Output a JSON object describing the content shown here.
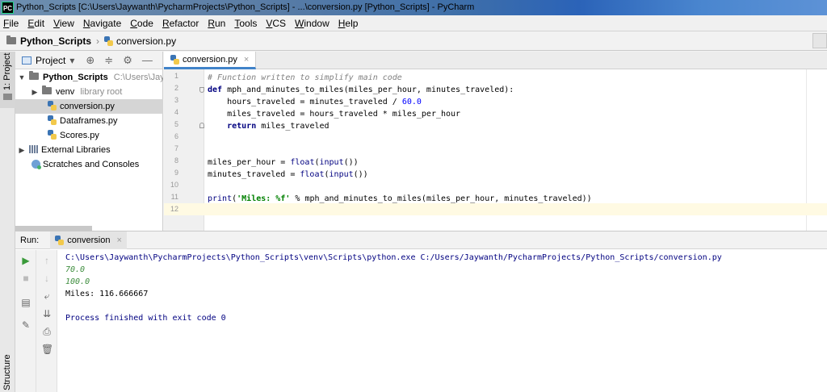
{
  "window": {
    "title": "Python_Scripts [C:\\Users\\Jaywanth\\PycharmProjects\\Python_Scripts] - ...\\conversion.py [Python_Scripts] - PyCharm",
    "logo_text": "PC"
  },
  "menu": [
    {
      "label": "File"
    },
    {
      "label": "Edit"
    },
    {
      "label": "View"
    },
    {
      "label": "Navigate"
    },
    {
      "label": "Code"
    },
    {
      "label": "Refactor"
    },
    {
      "label": "Run"
    },
    {
      "label": "Tools"
    },
    {
      "label": "VCS"
    },
    {
      "label": "Window"
    },
    {
      "label": "Help"
    }
  ],
  "breadcrumb": {
    "project": "Python_Scripts",
    "separator": "›",
    "file": "conversion.py"
  },
  "left_stripe": {
    "project_tab": "1: Project",
    "structure_tab": "Structure"
  },
  "project_panel": {
    "title": "Project",
    "dropdown_arrow": "▾",
    "tree": [
      {
        "label": "Python_Scripts",
        "hint": "C:\\Users\\Jaywa"
      },
      {
        "label": "venv",
        "hint": "library root"
      },
      {
        "label": "conversion.py"
      },
      {
        "label": "Dataframes.py"
      },
      {
        "label": "Scores.py"
      },
      {
        "label": "External Libraries"
      },
      {
        "label": "Scratches and Consoles"
      }
    ]
  },
  "editor": {
    "tab_label": "conversion.py",
    "close_glyph": "×",
    "line_numbers": [
      "1",
      "2",
      "3",
      "4",
      "5",
      "6",
      "7",
      "8",
      "9",
      "10",
      "11",
      "12"
    ],
    "lines": [
      "# Function written to simplify main code",
      "def mph_and_minutes_to_miles(miles_per_hour, minutes_traveled):",
      "    hours_traveled = minutes_traveled / 60.0",
      "    miles_traveled = hours_traveled * miles_per_hour",
      "    return miles_traveled",
      "",
      "",
      "miles_per_hour = float(input())",
      "minutes_traveled = float(input())",
      "",
      "print('Miles: %f' % mph_and_minutes_to_miles(miles_per_hour, minutes_traveled))",
      ""
    ]
  },
  "run_panel": {
    "title": "Run:",
    "tab_label": "conversion",
    "close_glyph": "×",
    "console": {
      "command": "C:\\Users\\Jaywanth\\PycharmProjects\\Python_Scripts\\venv\\Scripts\\python.exe C:/Users/Jaywanth/PycharmProjects/Python_Scripts/conversion.py",
      "input1": "70.0",
      "input2": "100.0",
      "output": "Miles: 116.666667",
      "exit": "Process finished with exit code 0"
    }
  },
  "colors": {
    "keyword": "#000080",
    "comment": "#808080",
    "number": "#0000ff",
    "string": "#008000",
    "console_input": "#3f8e3f",
    "run_play": "#3a9a3a",
    "tab_underline": "#4083c9"
  },
  "icons": {
    "locate": "crosshair-icon",
    "collapse": "collapse-icon",
    "settings": "gear-icon",
    "hide": "minimize-icon",
    "play": "play-icon",
    "stop": "stop-icon",
    "up": "up-arrow-icon",
    "down": "down-arrow-icon",
    "wrap": "soft-wrap-icon",
    "scroll_end": "scroll-to-end-icon",
    "print": "print-icon",
    "trash": "trash-icon",
    "layout": "layout-icon",
    "pin": "pin-icon"
  }
}
